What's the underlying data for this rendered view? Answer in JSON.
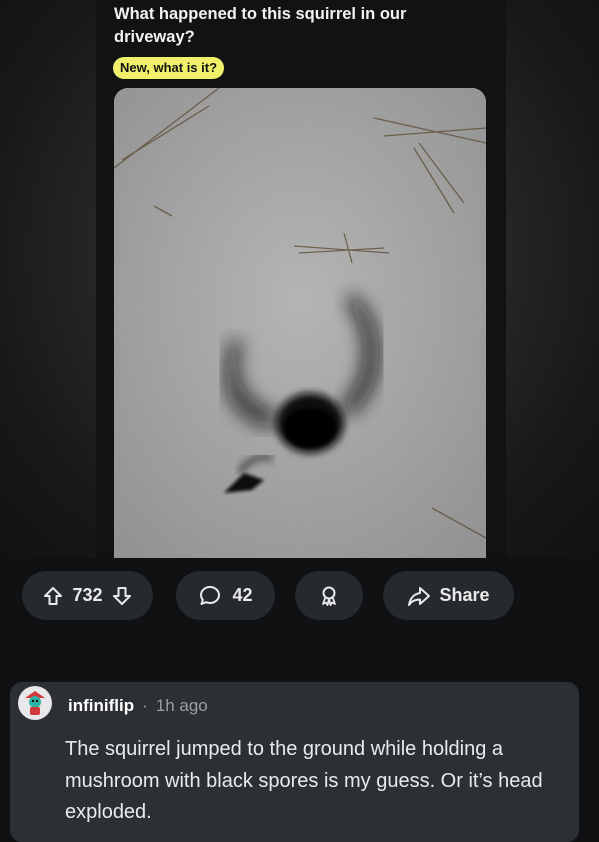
{
  "post": {
    "title": "What happened to this squirrel in our driveway?",
    "flair": "New, what is it?"
  },
  "actions": {
    "upvotes": "732",
    "comments": "42",
    "share_label": "Share"
  },
  "comment": {
    "username": "infiniflip",
    "separator": "·",
    "time": "1h ago",
    "text": "The squirrel jumped to the ground while holding a mushroom with black spores is my guess. Or it’s head exploded."
  },
  "icons": {
    "upvote": "arrow-up-icon",
    "downvote": "arrow-down-icon",
    "comment": "speech-bubble-icon",
    "award": "award-ribbon-icon",
    "share": "share-arrow-icon"
  }
}
